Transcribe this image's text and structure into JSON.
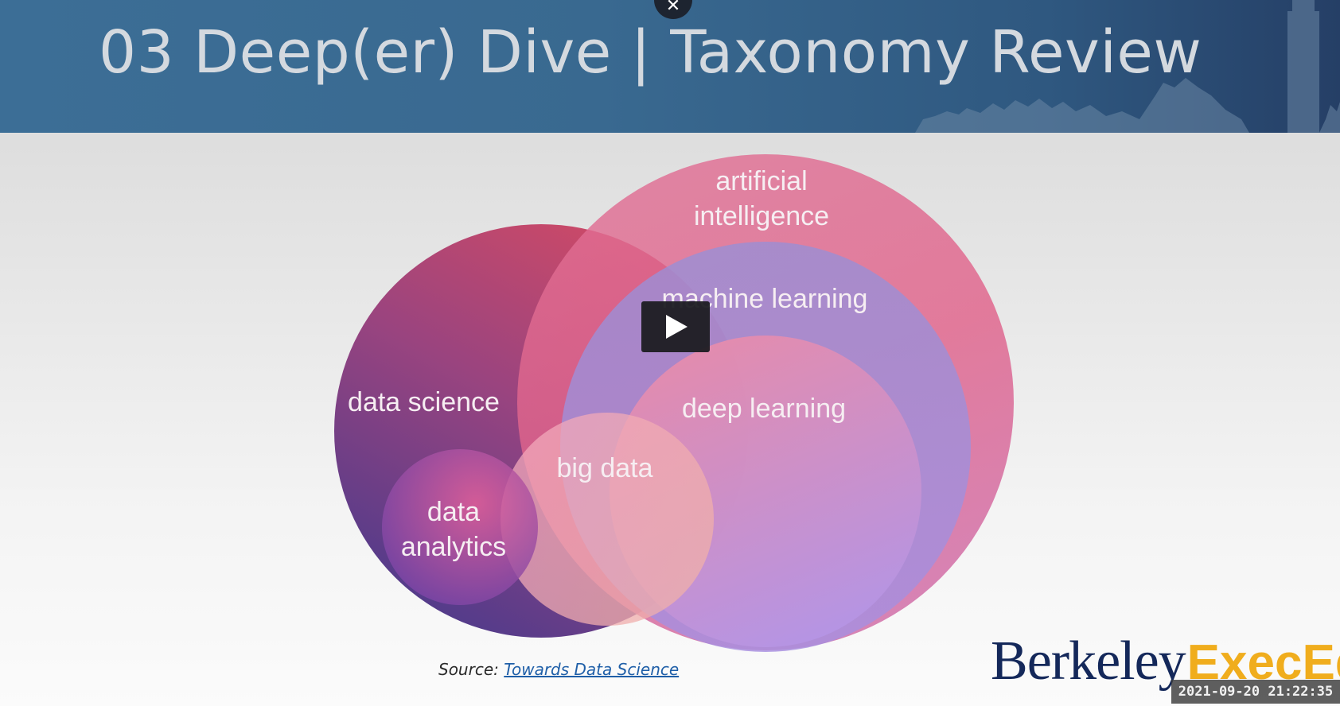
{
  "slide": {
    "title": "03 Deep(er) Dive | Taxonomy Review",
    "source_prefix": "Source:",
    "source_link": "Towards Data Science"
  },
  "venn": {
    "artificial_intelligence_line1": "artificial",
    "artificial_intelligence_line2": "intelligence",
    "machine_learning": "machine learning",
    "deep_learning": "deep learning",
    "data_science": "data science",
    "big_data": "big data",
    "data_analytics_line1": "data",
    "data_analytics_line2": "analytics"
  },
  "logo": {
    "part1": "Berkeley",
    "part2": "ExecEd"
  },
  "overlay": {
    "timestamp": "2021-09-20 21:22:35",
    "close_icon": "close-icon",
    "play_icon": "play-icon"
  },
  "colors": {
    "header": "#396990",
    "title": "#d4d9df",
    "logo_navy": "#14285a",
    "logo_gold": "#f0ad1d",
    "link": "#1f5fa8"
  }
}
